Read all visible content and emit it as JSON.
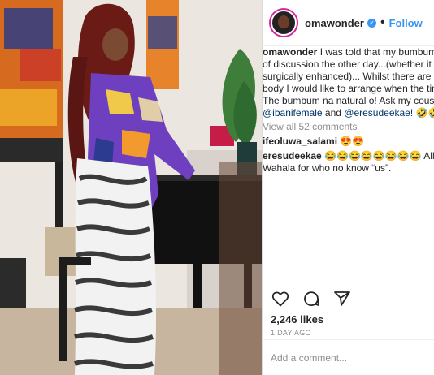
{
  "post": {
    "username": "omawonder",
    "follow_label": "Follow",
    "caption_lines": [
      "I was told that my bumbum wa",
      "of discussion the other day...(whether it wa",
      "surgically enhanced)... Whilst there are area",
      "body I would like to arrange when the time",
      "The bumbum na natural o! Ask my cousins"
    ],
    "mention1": "@ibanifemale",
    "and_text": "and",
    "mention2": "@eresudeekae!",
    "caption_emoji": "🤣🤣🤣🤣",
    "view_all": "View all 52 comments",
    "comments": [
      {
        "user": "ifeoluwa_salami",
        "text": "😍😍"
      },
      {
        "user": "eresudeekae",
        "text": "😂😂😂😂😂😂😂😂 All natural!",
        "text2": "Wahala for who no know “us”."
      }
    ],
    "likes": "2,246 likes",
    "date": "1 DAY AGO",
    "add_comment_placeholder": "Add a comment..."
  },
  "icons": [
    "heart-icon",
    "comment-icon",
    "share-icon"
  ],
  "colors": {
    "accent": "#3897f0",
    "text": "#262626",
    "muted": "#8e8e8e"
  }
}
